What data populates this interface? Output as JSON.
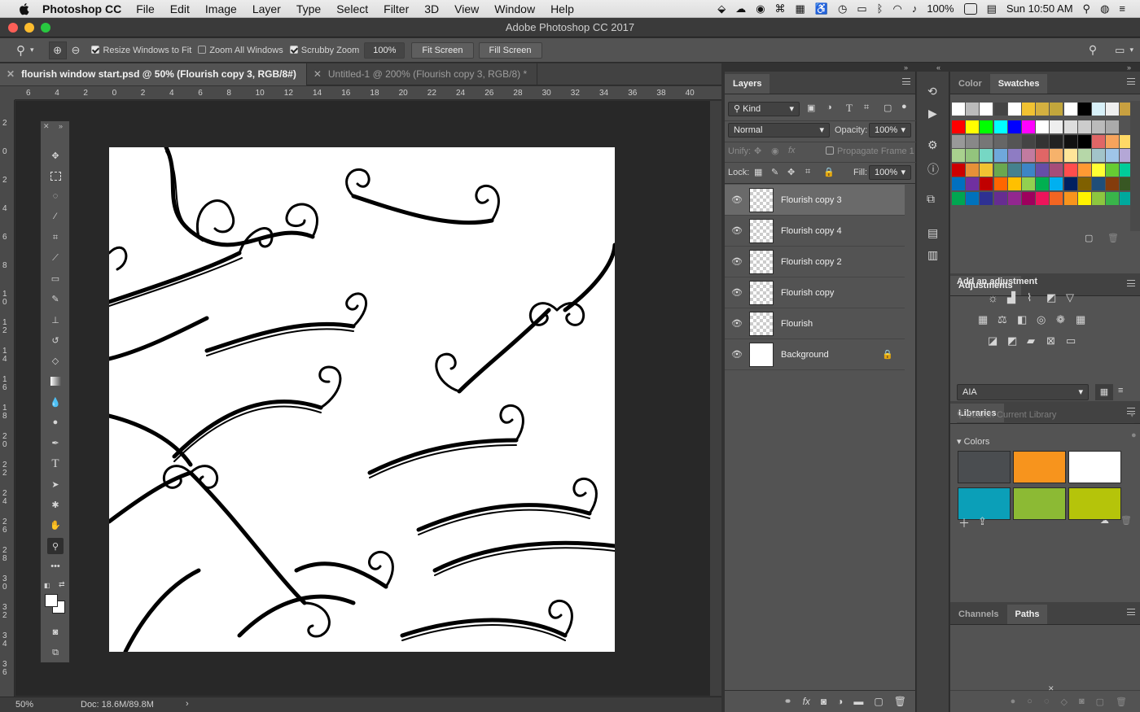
{
  "menubar": {
    "app_name": "Photoshop CC",
    "items": [
      "File",
      "Edit",
      "Image",
      "Layer",
      "Type",
      "Select",
      "Filter",
      "3D",
      "View",
      "Window",
      "Help"
    ],
    "battery": "100%",
    "clock": "Sun 10:50 AM"
  },
  "window": {
    "title": "Adobe Photoshop CC 2017"
  },
  "options": {
    "resize_label": "Resize Windows to Fit",
    "zoom_all_label": "Zoom All Windows",
    "scrubby_label": "Scrubby Zoom",
    "zoom_value": "100%",
    "fit_screen": "Fit Screen",
    "fill_screen": "Fill Screen"
  },
  "doc_tabs": [
    {
      "label": "flourish window start.psd @ 50% (Flourish  copy 3, RGB/8#)",
      "active": true
    },
    {
      "label": "Untitled-1 @ 200% (Flourish  copy 3, RGB/8) *",
      "active": false
    }
  ],
  "ruler_h": [
    "6",
    "4",
    "2",
    "0",
    "2",
    "4",
    "6",
    "8",
    "10",
    "12",
    "14",
    "16",
    "18",
    "20",
    "22",
    "24",
    "26",
    "28",
    "30",
    "32",
    "34",
    "36",
    "38",
    "40"
  ],
  "ruler_v": [
    "2",
    "0",
    "2",
    "4",
    "6",
    "8",
    "1 0",
    "1 2",
    "1 4",
    "1 6",
    "1 8",
    "2 0",
    "2 2",
    "2 4",
    "2 6",
    "2 8",
    "3 0",
    "3 2",
    "3 4",
    "3 6"
  ],
  "status": {
    "zoom": "50%",
    "doc": "Doc: 18.6M/89.8M"
  },
  "layers_panel": {
    "tab": "Layers",
    "filter_kind": "Kind",
    "blend_mode": "Normal",
    "opacity_label": "Opacity:",
    "opacity_value": "100%",
    "unify_label": "Unify:",
    "propagate_label": "Propagate Frame 1",
    "lock_label": "Lock:",
    "fill_label": "Fill:",
    "fill_value": "100%",
    "layers": [
      {
        "name": "Flourish  copy 3",
        "selected": true
      },
      {
        "name": "Flourish  copy 4",
        "selected": false
      },
      {
        "name": "Flourish  copy 2",
        "selected": false
      },
      {
        "name": "Flourish  copy",
        "selected": false
      },
      {
        "name": "Flourish",
        "selected": false
      },
      {
        "name": "Background",
        "selected": false,
        "locked": true
      }
    ]
  },
  "color_panel": {
    "tabs": [
      "Color",
      "Swatches"
    ],
    "active": "Swatches"
  },
  "adjustments_panel": {
    "title": "Adjustments",
    "subtitle": "Add an adjustment"
  },
  "libraries_panel": {
    "title": "Libraries",
    "library": "AIA",
    "search_placeholder": "Search Current Library",
    "colors_label": "Colors",
    "colors": [
      "#4a4d50",
      "#f7941d",
      "#ffffff",
      "#0b9fb8",
      "#8cba34",
      "#b5c40a"
    ]
  },
  "bottom_panel": {
    "tabs": [
      "Channels",
      "Paths"
    ],
    "active": "Paths"
  },
  "swatch_rows": [
    [
      "#ffffff",
      "#bbbbbb",
      "#ffffff",
      "#444444",
      "#ffffff",
      "#f1c232",
      "#d4b040",
      "#c2a63c",
      "#ffffff",
      "#000000",
      "#d8f0f8",
      "#efefef",
      "#c8a040"
    ],
    [
      "#ff0000",
      "#ffff00",
      "#00ff00",
      "#00ffff",
      "#0000ff",
      "#ff00ff",
      "#ffffff",
      "#eeeeee",
      "#dddddd",
      "#cccccc",
      "#bbbbbb",
      "#aaaaaa"
    ],
    [
      "#999999",
      "#888888",
      "#777777",
      "#666666",
      "#555555",
      "#444444",
      "#333333",
      "#222222",
      "#111111",
      "#000000",
      "#e06666",
      "#f6a35c",
      "#ffd966",
      "#fff2a8"
    ],
    [
      "#a9d18e",
      "#93c47d",
      "#76d7c4",
      "#6fa8dc",
      "#8e7cc3",
      "#c27ba0",
      "#e06666",
      "#f6b26b",
      "#ffe599",
      "#b6d7a8",
      "#a2c4c9",
      "#9fc5e8",
      "#b4a7d6",
      "#ea9999"
    ],
    [
      "#cc0000",
      "#e69138",
      "#f1c232",
      "#6aa84f",
      "#45818e",
      "#3d85c6",
      "#674ea7",
      "#a64d79",
      "#ff4d4d",
      "#ff9933",
      "#ffff33",
      "#66cc33",
      "#00cc99",
      "#3399ff"
    ],
    [
      "#0070c0",
      "#7030a0",
      "#c00000",
      "#ff6600",
      "#ffc000",
      "#92d050",
      "#00b050",
      "#00b0f0",
      "#002060",
      "#7f6000",
      "#1f4e79",
      "#843c0c",
      "#385723",
      "#7f7f7f"
    ],
    [
      "#00a651",
      "#0072bc",
      "#2e3192",
      "#662d91",
      "#92278f",
      "#9e005d",
      "#ed145b",
      "#f26522",
      "#f7941d",
      "#fff200",
      "#8dc63f",
      "#39b54a",
      "#00a99d",
      "#00aeef"
    ]
  ]
}
